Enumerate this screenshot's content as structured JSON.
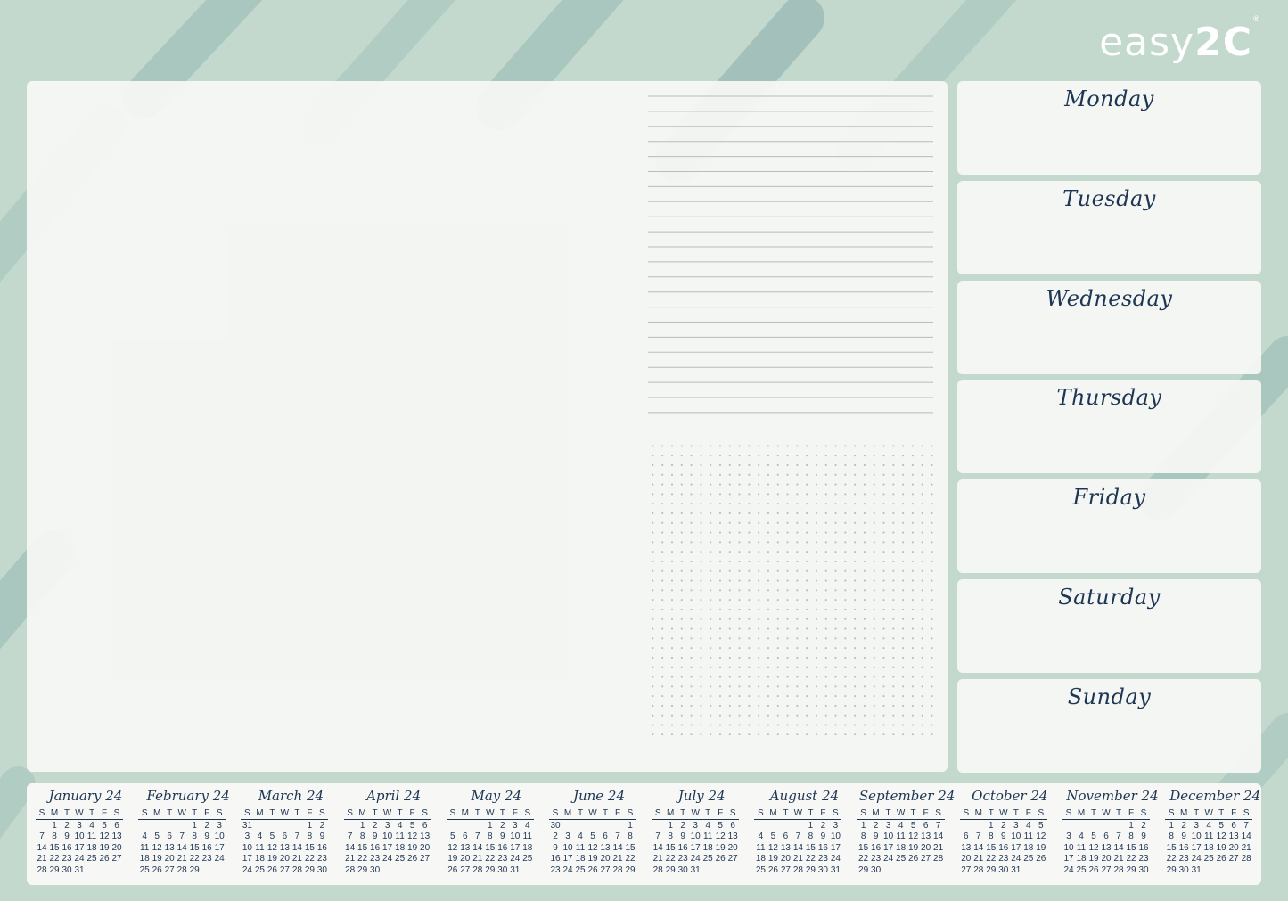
{
  "brand": {
    "name_light": "easy",
    "name_bold": "2C",
    "registered": "®"
  },
  "colors": {
    "background": "#c3d9cd",
    "ink": "#1e3554",
    "panel": "#f6f7f4"
  },
  "days": [
    "Monday",
    "Tuesday",
    "Wednesday",
    "Thursday",
    "Friday",
    "Saturday",
    "Sunday"
  ],
  "weekday_headers": [
    "S",
    "M",
    "T",
    "W",
    "T",
    "F",
    "S"
  ],
  "calendar": [
    {
      "name": "January 24",
      "rows": [
        [
          "",
          "1",
          "2",
          "3",
          "4",
          "5",
          "6"
        ],
        [
          "7",
          "8",
          "9",
          "10",
          "11",
          "12",
          "13"
        ],
        [
          "14",
          "15",
          "16",
          "17",
          "18",
          "19",
          "20"
        ],
        [
          "21",
          "22",
          "23",
          "24",
          "25",
          "26",
          "27"
        ],
        [
          "28",
          "29",
          "30",
          "31",
          "",
          "",
          ""
        ]
      ]
    },
    {
      "name": "February 24",
      "rows": [
        [
          "",
          "",
          "",
          "",
          "1",
          "2",
          "3"
        ],
        [
          "4",
          "5",
          "6",
          "7",
          "8",
          "9",
          "10"
        ],
        [
          "11",
          "12",
          "13",
          "14",
          "15",
          "16",
          "17"
        ],
        [
          "18",
          "19",
          "20",
          "21",
          "22",
          "23",
          "24"
        ],
        [
          "25",
          "26",
          "27",
          "28",
          "29",
          "",
          ""
        ]
      ]
    },
    {
      "name": "March 24",
      "rows": [
        [
          "31",
          "",
          "",
          "",
          "",
          "1",
          "2"
        ],
        [
          "3",
          "4",
          "5",
          "6",
          "7",
          "8",
          "9"
        ],
        [
          "10",
          "11",
          "12",
          "13",
          "14",
          "15",
          "16"
        ],
        [
          "17",
          "18",
          "19",
          "20",
          "21",
          "22",
          "23"
        ],
        [
          "24",
          "25",
          "26",
          "27",
          "28",
          "29",
          "30"
        ]
      ]
    },
    {
      "name": "April 24",
      "rows": [
        [
          "",
          "1",
          "2",
          "3",
          "4",
          "5",
          "6"
        ],
        [
          "7",
          "8",
          "9",
          "10",
          "11",
          "12",
          "13"
        ],
        [
          "14",
          "15",
          "16",
          "17",
          "18",
          "19",
          "20"
        ],
        [
          "21",
          "22",
          "23",
          "24",
          "25",
          "26",
          "27"
        ],
        [
          "28",
          "29",
          "30",
          "",
          "",
          "",
          ""
        ]
      ]
    },
    {
      "name": "May 24",
      "rows": [
        [
          "",
          "",
          "",
          "1",
          "2",
          "3",
          "4"
        ],
        [
          "5",
          "6",
          "7",
          "8",
          "9",
          "10",
          "11"
        ],
        [
          "12",
          "13",
          "14",
          "15",
          "16",
          "17",
          "18"
        ],
        [
          "19",
          "20",
          "21",
          "22",
          "23",
          "24",
          "25"
        ],
        [
          "26",
          "27",
          "28",
          "29",
          "30",
          "31",
          ""
        ]
      ]
    },
    {
      "name": "June 24",
      "rows": [
        [
          "30",
          "",
          "",
          "",
          "",
          "",
          "1"
        ],
        [
          "2",
          "3",
          "4",
          "5",
          "6",
          "7",
          "8"
        ],
        [
          "9",
          "10",
          "11",
          "12",
          "13",
          "14",
          "15"
        ],
        [
          "16",
          "17",
          "18",
          "19",
          "20",
          "21",
          "22"
        ],
        [
          "23",
          "24",
          "25",
          "26",
          "27",
          "28",
          "29"
        ]
      ]
    },
    {
      "name": "July 24",
      "rows": [
        [
          "",
          "1",
          "2",
          "3",
          "4",
          "5",
          "6"
        ],
        [
          "7",
          "8",
          "9",
          "10",
          "11",
          "12",
          "13"
        ],
        [
          "14",
          "15",
          "16",
          "17",
          "18",
          "19",
          "20"
        ],
        [
          "21",
          "22",
          "23",
          "24",
          "25",
          "26",
          "27"
        ],
        [
          "28",
          "29",
          "30",
          "31",
          "",
          "",
          ""
        ]
      ]
    },
    {
      "name": "August 24",
      "rows": [
        [
          "",
          "",
          "",
          "",
          "1",
          "2",
          "3"
        ],
        [
          "4",
          "5",
          "6",
          "7",
          "8",
          "9",
          "10"
        ],
        [
          "11",
          "12",
          "13",
          "14",
          "15",
          "16",
          "17"
        ],
        [
          "18",
          "19",
          "20",
          "21",
          "22",
          "23",
          "24"
        ],
        [
          "25",
          "26",
          "27",
          "28",
          "29",
          "30",
          "31"
        ]
      ]
    },
    {
      "name": "September 24",
      "rows": [
        [
          "1",
          "2",
          "3",
          "4",
          "5",
          "6",
          "7"
        ],
        [
          "8",
          "9",
          "10",
          "11",
          "12",
          "13",
          "14"
        ],
        [
          "15",
          "16",
          "17",
          "18",
          "19",
          "20",
          "21"
        ],
        [
          "22",
          "23",
          "24",
          "25",
          "26",
          "27",
          "28"
        ],
        [
          "29",
          "30",
          "",
          "",
          "",
          "",
          ""
        ]
      ]
    },
    {
      "name": "October 24",
      "rows": [
        [
          "",
          "",
          "1",
          "2",
          "3",
          "4",
          "5"
        ],
        [
          "6",
          "7",
          "8",
          "9",
          "10",
          "11",
          "12"
        ],
        [
          "13",
          "14",
          "15",
          "16",
          "17",
          "18",
          "19"
        ],
        [
          "20",
          "21",
          "22",
          "23",
          "24",
          "25",
          "26"
        ],
        [
          "27",
          "28",
          "29",
          "30",
          "31",
          "",
          ""
        ]
      ]
    },
    {
      "name": "November 24",
      "rows": [
        [
          "",
          "",
          "",
          "",
          "",
          "1",
          "2"
        ],
        [
          "3",
          "4",
          "5",
          "6",
          "7",
          "8",
          "9"
        ],
        [
          "10",
          "11",
          "12",
          "13",
          "14",
          "15",
          "16"
        ],
        [
          "17",
          "18",
          "19",
          "20",
          "21",
          "22",
          "23"
        ],
        [
          "24",
          "25",
          "26",
          "27",
          "28",
          "29",
          "30"
        ]
      ]
    },
    {
      "name": "December 24",
      "rows": [
        [
          "1",
          "2",
          "3",
          "4",
          "5",
          "6",
          "7"
        ],
        [
          "8",
          "9",
          "10",
          "11",
          "12",
          "13",
          "14"
        ],
        [
          "15",
          "16",
          "17",
          "18",
          "19",
          "20",
          "21"
        ],
        [
          "22",
          "23",
          "24",
          "25",
          "26",
          "27",
          "28"
        ],
        [
          "29",
          "30",
          "31",
          "",
          "",
          "",
          ""
        ]
      ]
    }
  ]
}
